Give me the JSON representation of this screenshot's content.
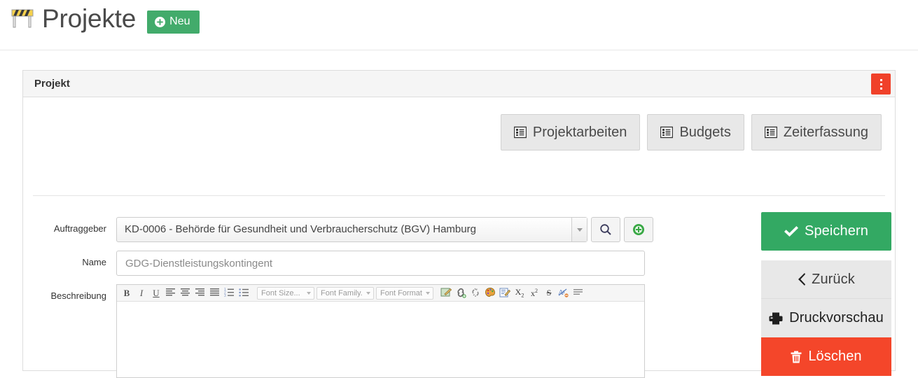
{
  "header": {
    "icon": "construction-barrier-icon",
    "title": "Projekte",
    "new_button_label": "Neu",
    "new_button_icon": "plus-circle-icon",
    "new_button_color": "#42ab6b"
  },
  "panel": {
    "title": "Projekt",
    "menu_icon": "vertical-ellipsis-icon",
    "menu_color": "#f0412a"
  },
  "nav_buttons": [
    {
      "label": "Projektarbeiten",
      "icon": "list-alt-icon"
    },
    {
      "label": "Budgets",
      "icon": "list-alt-icon"
    },
    {
      "label": "Zeiterfassung",
      "icon": "list-alt-icon"
    }
  ],
  "annotation": {
    "type": "arrow",
    "color": "#22a216",
    "points_to": "Projektarbeiten"
  },
  "form": {
    "auftraggeber": {
      "label": "Auftraggeber",
      "value": "KD-0006 - Behörde für Gesundheit und Verbraucherschutz (BGV) Hamburg",
      "search_icon": "search-icon",
      "add_icon": "plus-circle-green-icon"
    },
    "name": {
      "label": "Name",
      "value": "GDG-Dienstleistungskontingent",
      "placeholder": "GDG-Dienstleistungskontingent"
    },
    "beschreibung": {
      "label": "Beschreibung",
      "value": ""
    }
  },
  "editor_toolbar": {
    "bold": "B",
    "italic": "I",
    "underline": "U",
    "align_left_icon": "align-left-icon",
    "align_center_icon": "align-center-icon",
    "align_right_icon": "align-right-icon",
    "align_justify_icon": "align-justify-icon",
    "ordered_list_icon": "ordered-list-icon",
    "unordered_list_icon": "unordered-list-icon",
    "font_size_label": "Font Size...",
    "font_family_label": "Font Family.",
    "font_format_label": "Font Format",
    "image_icon": "insert-image-icon",
    "link_icon": "insert-link-icon",
    "unlink_icon": "unlink-icon",
    "color_icon": "color-palette-icon",
    "source_icon": "edit-source-icon",
    "subscript_icon": "subscript-icon",
    "superscript_icon": "superscript-icon",
    "strikethrough_icon": "strikethrough-icon",
    "remove_format_icon": "remove-format-icon",
    "paragraph_icon": "paragraph-icon",
    "subscript_text": "X",
    "subscript_sub": "2",
    "superscript_text": "x",
    "superscript_sup": "2",
    "strikethrough_text": "S"
  },
  "side_actions": [
    {
      "label": "Speichern",
      "icon": "check-icon",
      "color": "#33a963"
    },
    {
      "label": "Zurück",
      "icon": "chevron-left-icon",
      "color": "#e8e8e8"
    },
    {
      "label": "Druckvorschau",
      "icon": "printer-icon",
      "color": "#e8e8e8"
    },
    {
      "label": "Löschen",
      "icon": "trash-icon",
      "color": "#f4462a"
    }
  ]
}
